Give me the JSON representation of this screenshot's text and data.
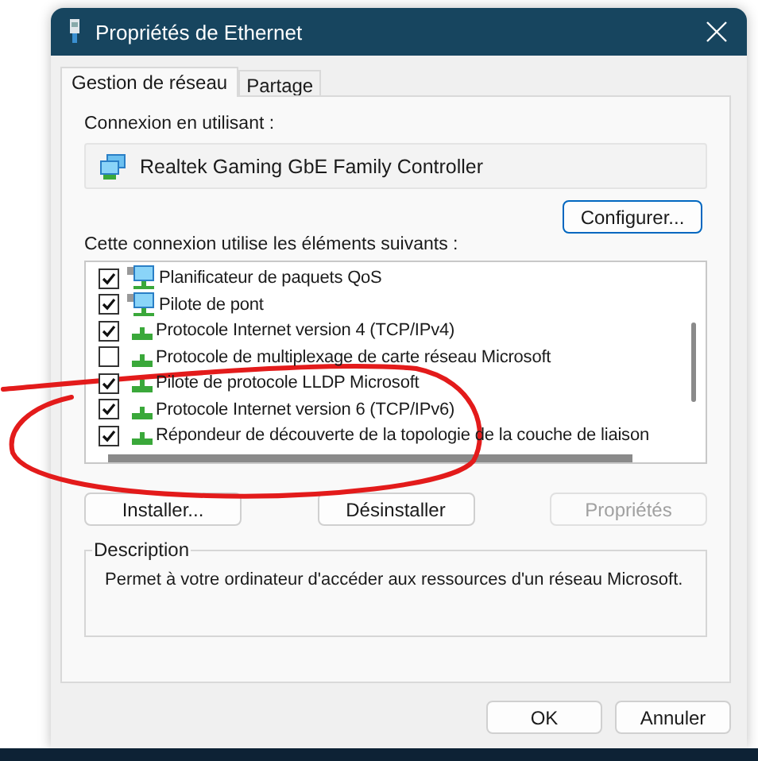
{
  "window": {
    "title": "Propriétés de Ethernet"
  },
  "tabs": [
    {
      "label": "Gestion de réseau",
      "selected": true
    },
    {
      "label": "Partage",
      "selected": false
    }
  ],
  "connection_label": "Connexion en utilisant :",
  "adapter": "Realtek Gaming GbE Family Controller",
  "configure_button": "Configurer...",
  "items_label": "Cette connexion utilise les éléments suivants :",
  "items": [
    {
      "label": "Planificateur de paquets QoS",
      "checked": true,
      "kind": "service"
    },
    {
      "label": "Pilote de pont",
      "checked": true,
      "kind": "service"
    },
    {
      "label": "Protocole Internet version 4 (TCP/IPv4)",
      "checked": true,
      "kind": "protocol"
    },
    {
      "label": "Protocole de multiplexage de carte réseau Microsoft",
      "checked": false,
      "kind": "protocol"
    },
    {
      "label": "Pilote de protocole LLDP Microsoft",
      "checked": true,
      "kind": "protocol"
    },
    {
      "label": "Protocole Internet version 6 (TCP/IPv6)",
      "checked": true,
      "kind": "protocol"
    },
    {
      "label": "Répondeur de découverte de la topologie de la couche de liaison",
      "checked": true,
      "kind": "protocol"
    }
  ],
  "buttons": [
    {
      "label": "Installer...",
      "disabled": false
    },
    {
      "label": "Désinstaller",
      "disabled": false
    },
    {
      "label": "Propriétés",
      "disabled": true
    }
  ],
  "description": {
    "title": "Description",
    "text": "Permet à votre ordinateur d'accéder aux ressources d'un réseau Microsoft."
  },
  "dialog_buttons": [
    "OK",
    "Annuler"
  ]
}
